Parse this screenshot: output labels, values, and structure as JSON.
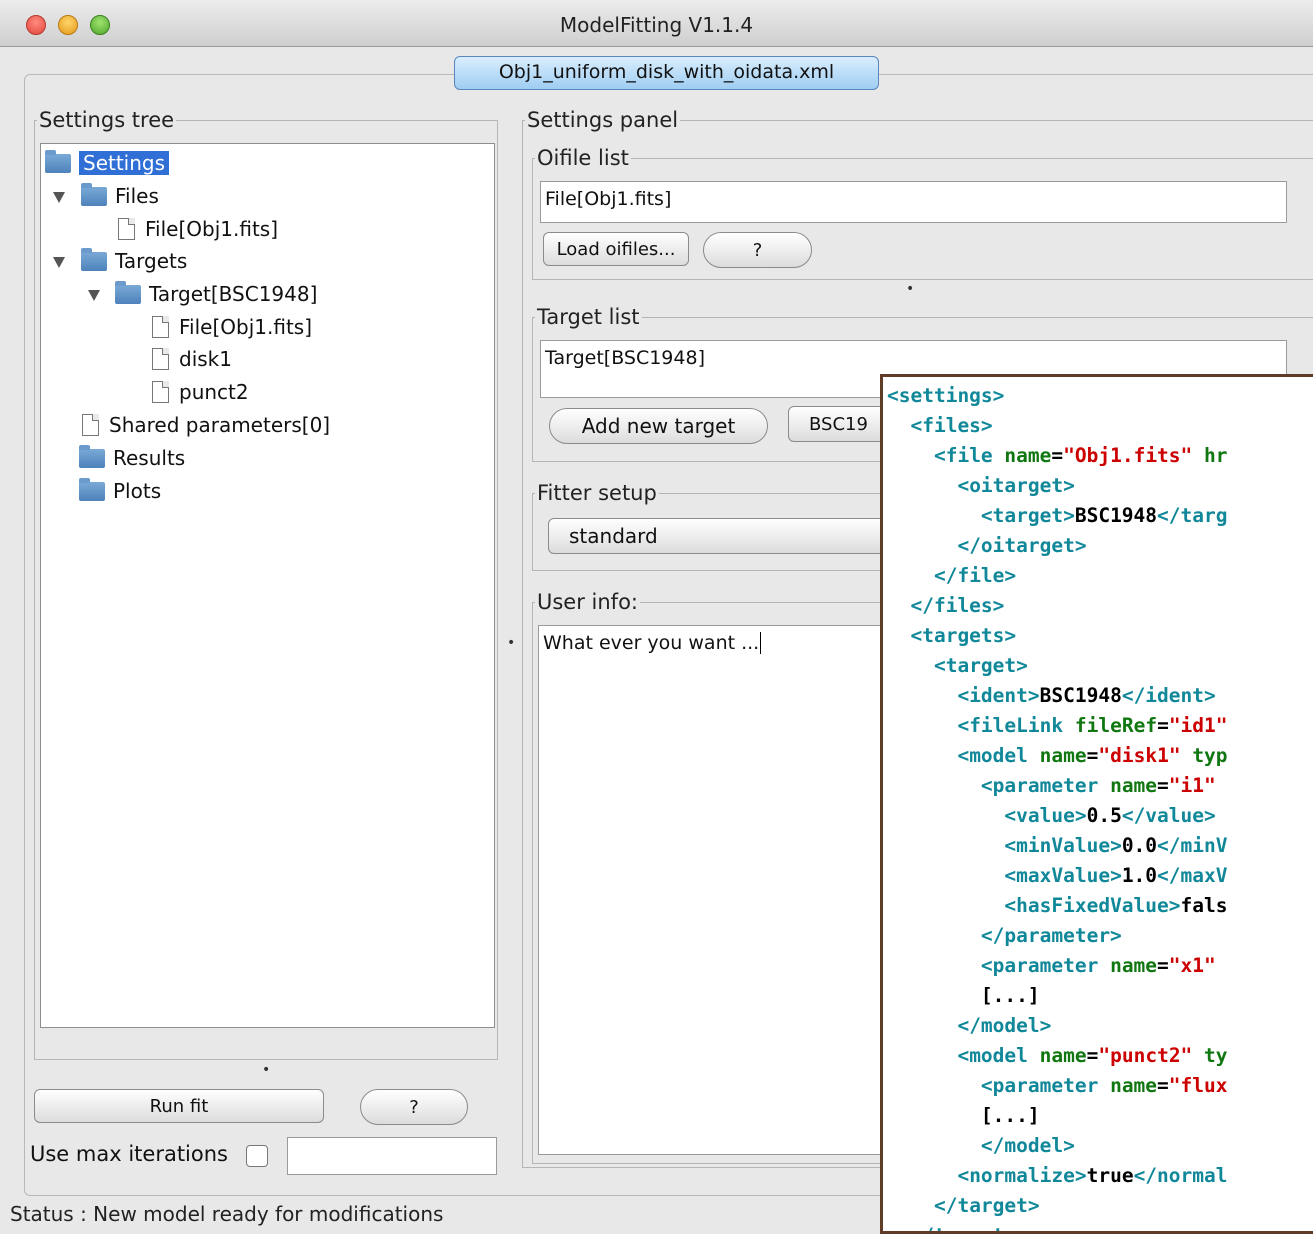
{
  "window": {
    "title": "ModelFitting V1.1.4"
  },
  "file_tab": "Obj1_uniform_disk_with_oidata.xml",
  "settings_tree": {
    "label": "Settings tree",
    "root": "Settings",
    "files": "Files",
    "file_item": "File[Obj1.fits]",
    "targets": "Targets",
    "target": "Target[BSC1948]",
    "target_file": "File[Obj1.fits]",
    "model1": "disk1",
    "model2": "punct2",
    "shared": "Shared parameters[0]",
    "results": "Results",
    "plots": "Plots"
  },
  "settings_panel": {
    "label": "Settings panel",
    "oifile": {
      "label": "Oifile list",
      "value": "File[Obj1.fits]",
      "load_button": "Load oifiles...",
      "help_button": "?"
    },
    "target_list": {
      "label": "Target list",
      "value": "Target[BSC1948]",
      "add_button": "Add new target",
      "bsc_button": "BSC19"
    },
    "fitter": {
      "label": "Fitter setup",
      "value": "standard"
    },
    "user_info": {
      "label": "User info:",
      "value": "What ever you want ..."
    }
  },
  "controls": {
    "run_fit": "Run fit",
    "help": "?",
    "use_max_iter": "Use max iterations"
  },
  "status": "Status : New model ready for modifications",
  "xml": {
    "l1": {
      "tag": "<settings>"
    },
    "l2": {
      "tag": "<files>"
    },
    "l3": {
      "open": "<file",
      "attr": "name",
      "val": "\"Obj1.fits\"",
      "rest": " hr"
    },
    "l4": {
      "tag": "<oitarget>"
    },
    "l5": {
      "open": "<target>",
      "text": "BSC1948",
      "close": "</targ"
    },
    "l6": {
      "tag": "</oitarget>"
    },
    "l7": {
      "tag": "</file>"
    },
    "l8": {
      "tag": "</files>"
    },
    "l9": {
      "tag": "<targets>"
    },
    "l10": {
      "tag": "<target>"
    },
    "l11": {
      "open": "<ident>",
      "text": "BSC1948",
      "close": "</ident>"
    },
    "l12": {
      "open": "<fileLink",
      "attr": "fileRef",
      "val": "\"id1\""
    },
    "l13": {
      "open": "<model",
      "attr": "name",
      "val": "\"disk1\"",
      "attr2": "typ"
    },
    "l14": {
      "open": "<parameter",
      "attr": "name",
      "val": "\"i1\""
    },
    "l15": {
      "open": "<value>",
      "text": "0.5",
      "close": "</value>"
    },
    "l16": {
      "open": "<minValue>",
      "text": "0.0",
      "close": "</minV"
    },
    "l17": {
      "open": "<maxValue>",
      "text": "1.0",
      "close": "</maxV"
    },
    "l18": {
      "open": "<hasFixedValue>",
      "text": "fals"
    },
    "l19": {
      "tag": "</parameter>"
    },
    "l20": {
      "open": "<parameter",
      "attr": "name",
      "val": "\"x1\""
    },
    "l21": {
      "text": "[...]"
    },
    "l22": {
      "tag": "</model>"
    },
    "l23": {
      "open": "<model",
      "attr": "name",
      "val": "\"punct2\"",
      "attr2": "ty"
    },
    "l24": {
      "open": "<parameter",
      "attr": "name",
      "val": "\"flux"
    },
    "l25": {
      "text": "[...]"
    },
    "l26": {
      "tag": "</model>"
    },
    "l27": {
      "open": "<normalize>",
      "text": "true",
      "close": "</normal"
    },
    "l28": {
      "tag": "</target>"
    },
    "l29": {
      "tag": "</targets>"
    }
  }
}
